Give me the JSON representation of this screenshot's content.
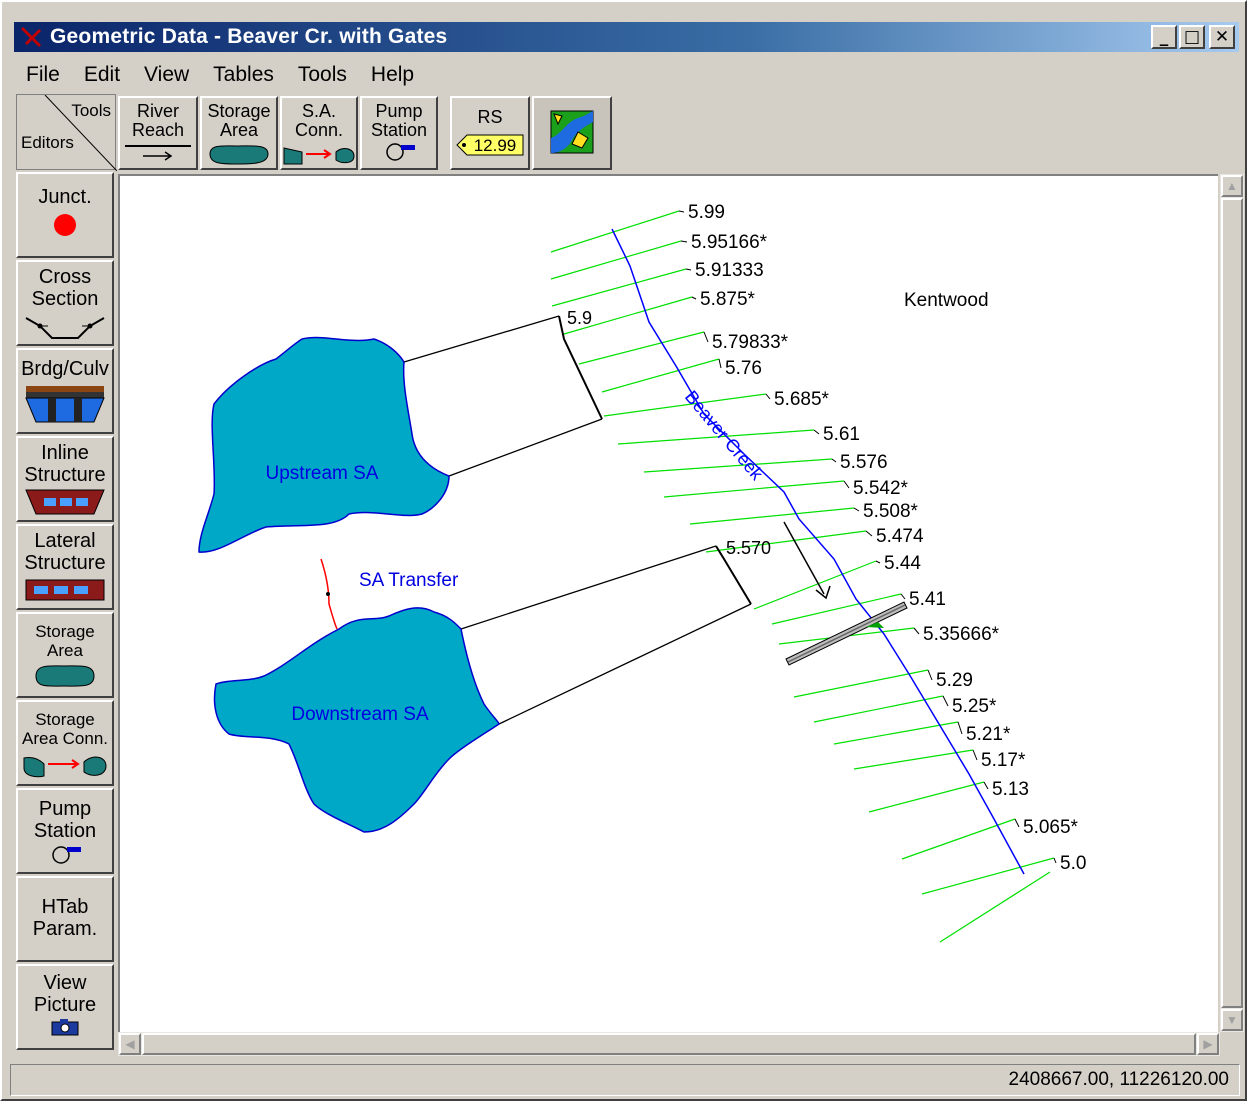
{
  "window": {
    "title": "Geometric Data - Beaver Cr. with Gates",
    "minimize": "_",
    "maximize": "□",
    "close": "✕"
  },
  "menu": [
    "File",
    "Edit",
    "View",
    "Tables",
    "Tools",
    "Help"
  ],
  "corner": {
    "tools": "Tools",
    "editors": "Editors"
  },
  "toolbar": {
    "river_reach": [
      "River",
      "Reach"
    ],
    "storage_area": [
      "Storage",
      "Area"
    ],
    "sa_conn": [
      "S.A.",
      "Conn."
    ],
    "pump_station": [
      "Pump",
      "Station"
    ],
    "rs": "RS",
    "rs_tag": "12.99",
    "map_icon": "map-icon"
  },
  "editors": {
    "junct": "Junct.",
    "cross_section": [
      "Cross",
      "Section"
    ],
    "brdg_culv": "Brdg/Culv",
    "inline_structure": [
      "Inline",
      "Structure"
    ],
    "lateral_structure": [
      "Lateral",
      "Structure"
    ],
    "storage_area": [
      "Storage",
      "Area"
    ],
    "storage_area_conn": [
      "Storage",
      "Area Conn."
    ],
    "pump_station": [
      "Pump",
      "Station"
    ],
    "htab_param": [
      "HTab",
      "Param."
    ],
    "view_picture": [
      "View",
      "Picture"
    ]
  },
  "map": {
    "river_label": "Beaver Creek",
    "town_label": "Kentwood",
    "upstream_sa": "Upstream SA",
    "downstream_sa": "Downstream SA",
    "sa_transfer": "SA Transfer",
    "lateral_upper_rs": "5.9",
    "lateral_lower_rs": "5.570",
    "cross_sections": [
      "5.99",
      "5.95166*",
      "5.91333",
      "5.875*",
      "5.79833*",
      "5.76",
      "5.685*",
      "5.61",
      "5.576",
      "5.542*",
      "5.508*",
      "5.474",
      "5.44",
      "5.41",
      "5.35666*",
      "5.29",
      "5.25*",
      "5.21*",
      "5.17*",
      "5.13",
      "5.065*",
      "5.0"
    ],
    "colors": {
      "xs": "#00e000",
      "river": "#0000ff",
      "sa_fill": "#00a8c8",
      "sa_label": "#0000e0",
      "link": "#ff0000"
    }
  },
  "status": {
    "coords": "2408667.00, 11226120.00"
  }
}
